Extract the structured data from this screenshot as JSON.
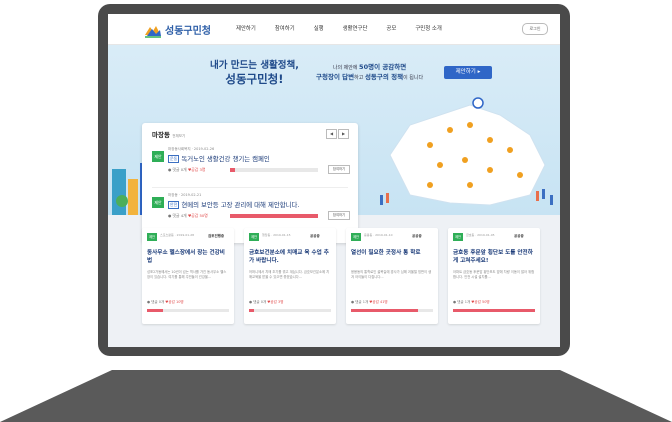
{
  "header": {
    "logo_text": "성동구민청",
    "nav": [
      "제안하기",
      "참여하기",
      "실행",
      "생활연구단",
      "공모",
      "구민청 소개"
    ],
    "login": "로그인"
  },
  "hero": {
    "title_line1": "내가 만드는 생활정책,",
    "title_line2": "성동구민청!",
    "sub_line1_pre": "나의 제안에 ",
    "sub_line1_bold": "50명이 공감하면",
    "sub_line2_bold1": "구청장이 답변",
    "sub_line2_mid": "하고 ",
    "sub_line2_bold2": "성동구의 정책",
    "sub_line2_post": "이 됩니다",
    "propose_button": "제안하기 ▸"
  },
  "panel": {
    "title": "마장동",
    "title_small": "전체보기",
    "prev": "◀",
    "next": "▶",
    "items": [
      {
        "badge": "제안",
        "meta": "마장동사회복지 · 2019-02-26",
        "tag": "운동",
        "title": "독거노인 생활건강 챙기는 캠페인",
        "stats": "● 댓글 0개  ",
        "likes": "♥공감 3명",
        "progress": 0.06,
        "more": "참여하기"
      },
      {
        "badge": "제안",
        "meta": "마장동 · 2019-02-21",
        "tag": "안전",
        "title": "현메의 보안등 고장 관리에 대해 제안합니다.",
        "stats": "● 댓글 4개  ",
        "likes": "♥공감 50명",
        "progress": 1.0,
        "more": "참여하기"
      }
    ]
  },
  "cards": [
    {
      "badge": "제안",
      "meta": "스포츠활동 · 2019-01-28",
      "status": "검토진행중",
      "title": "동사무소 헬스장에서 장는 건강비법",
      "desc": "성포2가동에서는 10년이 넘는 역사를 가진 동사무소 헬스장이 있습니다. 여기를 통해 주민들이 건강을...",
      "stats": "● 댓글 0개  ",
      "likes": "♥공감 10명",
      "progress": 0.2
    },
    {
      "badge": "제안",
      "meta": "행당동 · 2019-01-15",
      "status": "공공중",
      "title": "금호보건분소에 치매교 육 수업 추가 바랍니다.",
      "desc": "어머니께서 치매 초기를 겪고 계십니다. 금호보건분소에 치매교육을 받을 수 있으면 좋겠습니다...",
      "stats": "● 댓글 0개  ",
      "likes": "♥공감 3명",
      "progress": 0.06
    },
    {
      "badge": "제안",
      "meta": "응봉동 · 2019-01-10",
      "status": "공공중",
      "title": "열선이 필요한 곳정사 통 학로",
      "desc": "응봉동의 통학로인 골목길에 경사가 심해 겨울철 빙판이 생겨 아이들이 다칩니다...",
      "stats": "● 댓글 1개  ",
      "likes": "♥공감 41명",
      "progress": 0.82
    },
    {
      "badge": "제안",
      "meta": "금호동 · 2019-01-05",
      "status": "공공중",
      "title": "금호동 후문앞 횡단보 도를 안전하게 고쳐주세요!",
      "desc": "아파트 금호동 후문앞 횡단보도 앞에 차량 이동이 많아 위험합니다. 안전 시설 설치를...",
      "stats": "● 댓글 1개  ",
      "likes": "♥공감 50명",
      "progress": 1.0
    }
  ],
  "colors": {
    "accent": "#2f66c7",
    "brand": "#2e5fa8",
    "badge": "#2fae57",
    "like": "#e04848",
    "frame": "#4a4a4a",
    "base": "#555555"
  }
}
